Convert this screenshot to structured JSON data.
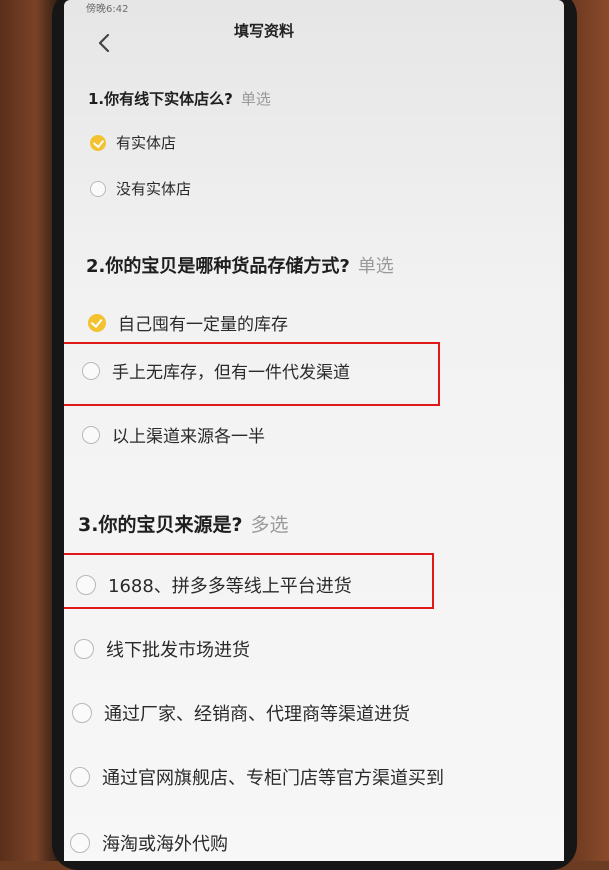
{
  "status_bar": {
    "text": "傍晚6:42"
  },
  "header": {
    "title": "填写资料"
  },
  "questions": [
    {
      "title": "1.你有线下实体店么?",
      "tag": "单选",
      "options": [
        {
          "label": "有实体店",
          "checked": true
        },
        {
          "label": "没有实体店",
          "checked": false
        }
      ]
    },
    {
      "title": "2.你的宝贝是哪种货品存储方式?",
      "tag": "单选",
      "options": [
        {
          "label": "自己囤有一定量的库存",
          "checked": true
        },
        {
          "label": "手上无库存，但有一件代发渠道",
          "checked": false
        },
        {
          "label": "以上渠道来源各一半",
          "checked": false
        }
      ]
    },
    {
      "title": "3.你的宝贝来源是?",
      "tag": "多选",
      "options": [
        {
          "label": "1688、拼多多等线上平台进货",
          "checked": false
        },
        {
          "label": "线下批发市场进货",
          "checked": false
        },
        {
          "label": "通过厂家、经销商、代理商等渠道进货",
          "checked": false
        },
        {
          "label": "通过官网旗舰店、专柜门店等官方渠道买到",
          "checked": false
        },
        {
          "label": "海淘或海外代购",
          "checked": false
        }
      ]
    }
  ],
  "colors": {
    "accent": "#f2c230",
    "highlight_box": "#e01818",
    "background": "#f4f4f4"
  }
}
